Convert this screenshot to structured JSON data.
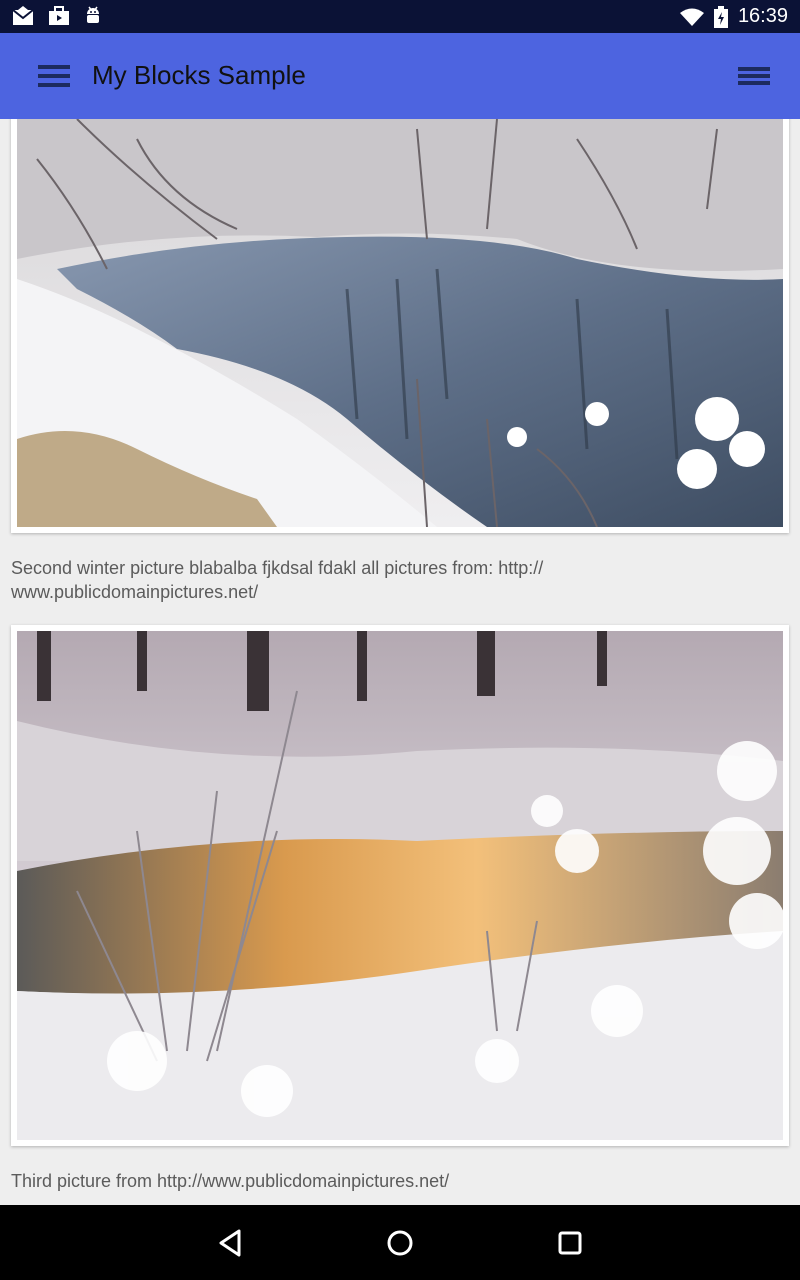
{
  "status_bar": {
    "time": "16:39",
    "icons": [
      "mail-icon",
      "briefcase-icon",
      "android-icon",
      "wifi-icon",
      "battery-icon"
    ]
  },
  "app_bar": {
    "title": "My Blocks Sample",
    "color": "#4d64e0",
    "icons": [
      "hamburger-menu-icon",
      "overflow-menu-icon"
    ]
  },
  "feed": {
    "items": [
      {
        "image": "Winter river with snowy banks and reflections",
        "caption": "Second winter picture blabalba fjkdsal fdakl all pictures from: http://\nwww.publicdomainpictures.net/"
      },
      {
        "image": "Frosted plants by a stream at sunrise",
        "caption": "Third picture from http://www.publicdomainpictures.net/"
      }
    ]
  },
  "nav_bar": {
    "icons": [
      "back-icon",
      "home-icon",
      "recents-icon"
    ]
  }
}
